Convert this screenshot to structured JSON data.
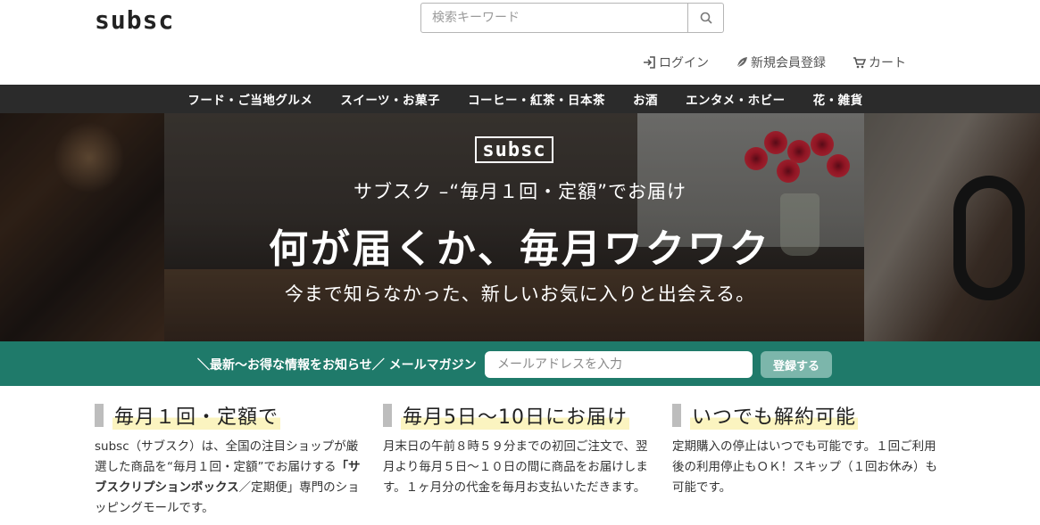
{
  "header": {
    "logo": "subsc",
    "search": {
      "placeholder": "検索キーワード"
    },
    "user_nav": [
      {
        "label": "ログイン",
        "icon": "login-icon"
      },
      {
        "label": "新規会員登録",
        "icon": "leaf-icon"
      },
      {
        "label": "カート",
        "icon": "cart-icon"
      }
    ]
  },
  "categories": [
    "フード・ご当地グルメ",
    "スイーツ・お菓子",
    "コーヒー・紅茶・日本茶",
    "お酒",
    "エンタメ・ホビー",
    "花・雑貨"
  ],
  "hero": {
    "logo": "subsc",
    "subtitle": "サブスク –“毎月１回・定額”でお届け",
    "title": "何が届くか、毎月ワクワク",
    "description": "今まで知らなかった、新しいお気に入りと出会える。"
  },
  "newsletter": {
    "label": "＼最新〜お得な情報をお知らせ／ メールマガジン",
    "placeholder": "メールアドレスを入力",
    "button": "登録する"
  },
  "features": [
    {
      "title": "毎月１回・定額で",
      "text_pre": "subsc（サブスク）は、全国の注目ショップが厳選した商品を“毎月１回・定額”でお届けする",
      "text_bold": "「サブスクリプションボックス",
      "text_post": "／定期便」専門のショッピングモールです。"
    },
    {
      "title": "毎月5日〜10日にお届け",
      "text": "月末日の午前８時５９分までの初回ご注文で、翌月より毎月５日〜１０日の間に商品をお届けします。１ヶ月分の代金を毎月お支払いただきます。"
    },
    {
      "title": "いつでも解約可能",
      "text": "定期購入の停止はいつでも可能です。１回ご利用後の利用停止もＯＫ！スキップ（１回お休み）も可能です。"
    }
  ],
  "colors": {
    "accent": "#1f7a6a",
    "catbar": "#2b2b2b",
    "highlight": "#fbf4c0"
  }
}
